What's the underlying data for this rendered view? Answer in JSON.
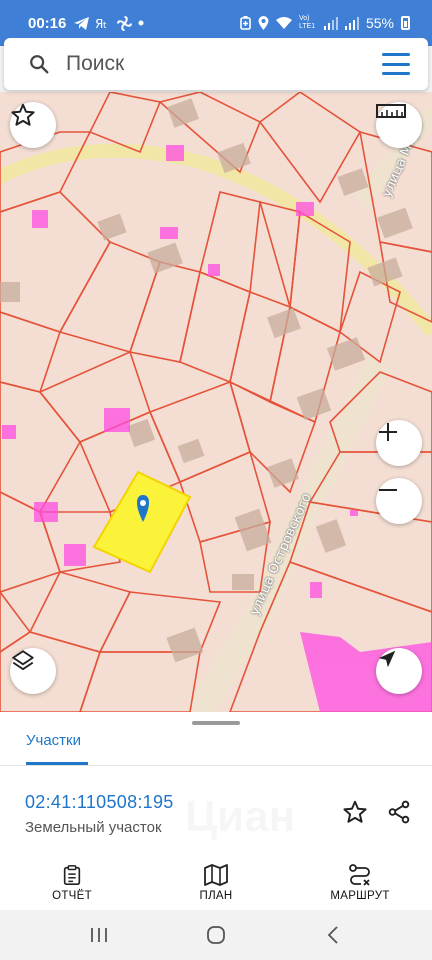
{
  "status": {
    "time": "00:16",
    "battery": "55%",
    "network": "Vo) LTE1",
    "left_icons": [
      "telegram-icon",
      "ya-icon",
      "fan-icon",
      "dot-icon"
    ],
    "right_icons": [
      "battery-saver-icon",
      "location-icon",
      "wifi-icon",
      "signal-icon",
      "signal-icon"
    ]
  },
  "search": {
    "placeholder": "Поиск"
  },
  "map": {
    "street_label_1": "улица Островского",
    "street_label_2": "улица Мира",
    "colors": {
      "background": "#f4ded3",
      "parcel_border": "#e5533a",
      "road": "#f2e6a6",
      "building": "#c9ad9c",
      "highlight": "#ff4de1",
      "selected": "#fbf23a"
    }
  },
  "sheet": {
    "tab_label": "Участки",
    "parcel_number": "02:41:110508:195",
    "parcel_type": "Земельный участок",
    "watermark": "Циан"
  },
  "actions": {
    "report": "ОТЧЁТ",
    "plan": "ПЛАН",
    "route": "МАРШРУТ"
  },
  "accent_color": "#1f76c9"
}
